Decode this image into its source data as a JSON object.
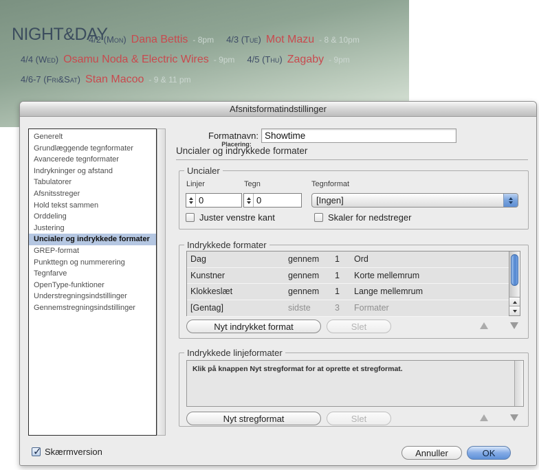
{
  "banner": {
    "title": "NIGHT&DAY",
    "lines": [
      {
        "segments": [
          {
            "kind": "date",
            "text": "4/2 (Mon)"
          },
          {
            "kind": "name",
            "text": "Dana Bettis"
          },
          {
            "kind": "time",
            "text": "- 8pm"
          },
          {
            "kind": "date",
            "text": "4/3 (Tue)"
          },
          {
            "kind": "name",
            "text": "Mot Mazu"
          },
          {
            "kind": "time",
            "text": "- 8 & 10pm"
          }
        ]
      },
      {
        "segments": [
          {
            "kind": "date",
            "text": "4/4 (Wed)"
          },
          {
            "kind": "name",
            "text": "Osamu Noda & Electric Wires"
          },
          {
            "kind": "time",
            "text": "- 9pm"
          },
          {
            "kind": "date",
            "text": "4/5 (Thu)"
          },
          {
            "kind": "name",
            "text": "Zagaby"
          },
          {
            "kind": "time",
            "text": "- 9pm"
          }
        ]
      },
      {
        "segments": [
          {
            "kind": "date",
            "text": "4/6-7 (Fri&Sat)"
          },
          {
            "kind": "name",
            "text": "Stan Macoo"
          },
          {
            "kind": "time",
            "text": "- 9 & 11 pm"
          }
        ]
      }
    ],
    "colors": {
      "title": "#3c4d5e",
      "date": "#3e4c66",
      "name": "#c84a4e",
      "time": "#ccd7d1"
    }
  },
  "dialog": {
    "title": "Afsnitsformatindstillinger",
    "sidebar": {
      "items": [
        "Generelt",
        "Grundlæggende tegnformater",
        "Avancerede tegnformater",
        "Indrykninger og afstand",
        "Tabulatorer",
        "Afsnitsstreger",
        "Hold tekst sammen",
        "Orddeling",
        "Justering",
        "Uncialer og indrykkede formater",
        "GREP-format",
        "Punkttegn og nummerering",
        "Tegnfarve",
        "OpenType-funktioner",
        "Understregningsindstillinger",
        "Gennemstregningsindstillinger"
      ],
      "selected_index": 9
    },
    "format_name": {
      "label": "Formatnavn:",
      "value": "Showtime"
    },
    "placement_label": "Placering:",
    "section_heading": "Uncialer og indrykkede formater",
    "drop_caps": {
      "group_label": "Uncialer",
      "lines": {
        "label": "Linjer",
        "value": "0"
      },
      "characters": {
        "label": "Tegn",
        "value": "0"
      },
      "char_style": {
        "label": "Tegnformat",
        "value": "[Ingen]"
      },
      "align_left": {
        "label": "Juster venstre kant",
        "checked": false
      },
      "scale_descenders": {
        "label": "Skaler for nedstreger",
        "checked": false
      }
    },
    "nested_styles": {
      "group_label": "Indrykkede formater",
      "rows": [
        {
          "style": "Dag",
          "through": "gennem",
          "count": "1",
          "unit": "Ord",
          "muted": false
        },
        {
          "style": "Kunstner",
          "through": "gennem",
          "count": "1",
          "unit": "Korte mellemrum",
          "muted": false
        },
        {
          "style": "Klokkeslæt",
          "through": "gennem",
          "count": "1",
          "unit": "Lange mellemrum",
          "muted": false
        },
        {
          "style": "[Gentag]",
          "through": "sidste",
          "count": "3",
          "unit": "Formater",
          "muted": true
        }
      ],
      "new_button": "Nyt indrykket format",
      "delete_button": "Slet"
    },
    "line_styles": {
      "group_label": "Indrykkede linjeformater",
      "empty_message": "Klik på knappen Nyt stregformat for at oprette et stregformat.",
      "new_button": "Nyt stregformat",
      "delete_button": "Slet"
    },
    "footer": {
      "preview_checkbox": {
        "label": "Skærmversion",
        "checked": true
      },
      "cancel_button": "Annuller",
      "ok_button": "OK"
    }
  }
}
